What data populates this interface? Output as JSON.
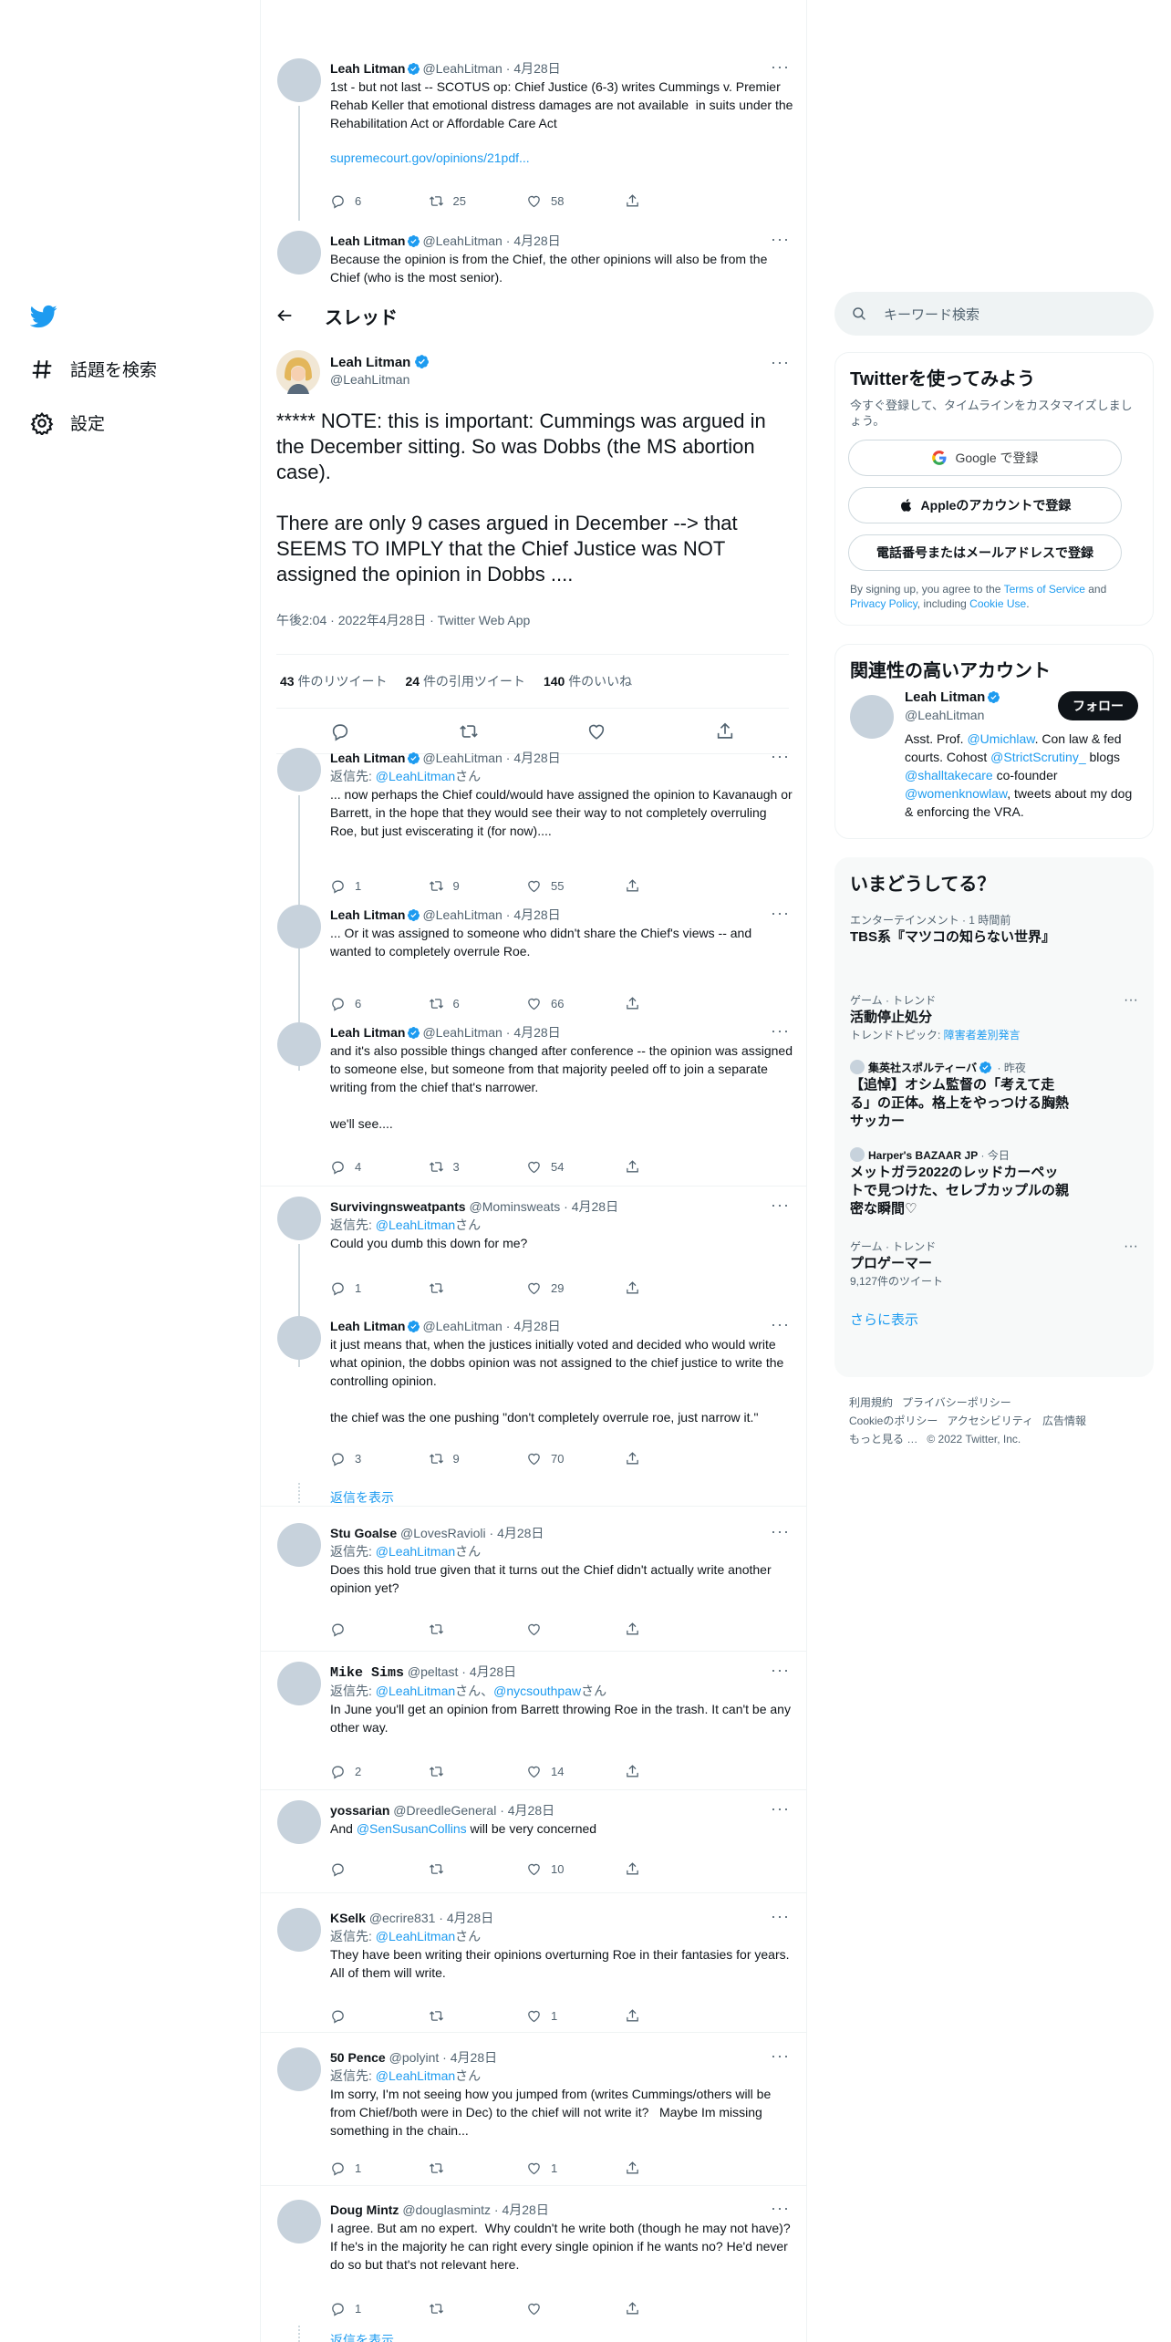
{
  "nav": {
    "explore_label": "話題を検索",
    "settings_label": "設定"
  },
  "thread_header": {
    "title": "スレッド"
  },
  "verified_color": "#1d9bf0",
  "link_color": "#1d9bf0",
  "above_tweets": [
    {
      "name": "Leah Litman",
      "verified": true,
      "handle": "@LeahLitman",
      "time": "4月28日",
      "text": "1st - but not last -- SCOTUS op: Chief Justice (6-3) writes Cummings v. Premier Rehab Keller that emotional distress damages are not available  in suits under the Rehabilitation Act or Affordable Care Act",
      "link": "supremecourt.gov/opinions/21pdf...",
      "reply_count": "6",
      "retweet_count": "25",
      "like_count": "58"
    },
    {
      "name": "Leah Litman",
      "verified": true,
      "handle": "@LeahLitman",
      "time": "4月28日",
      "text": "Because the opinion is from the Chief, the other opinions will also be from the Chief (who is the most senior)."
    }
  ],
  "focus": {
    "name": "Leah Litman",
    "handle": "@LeahLitman",
    "text": "***** NOTE: this is important: Cummings was argued in the December sitting. So was Dobbs (the MS abortion case).\n\nThere are only 9 cases argued in December --> that SEEMS TO IMPLY that the Chief Justice was NOT assigned the opinion in Dobbs ....",
    "meta": "午後2:04 · 2022年4月28日 · Twitter Web App",
    "retweets": "43",
    "retweets_label": "件のリツイート",
    "quotes": "24",
    "quotes_label": "件の引用ツイート",
    "likes": "140",
    "likes_label": "件のいいね"
  },
  "replies": [
    {
      "name": "Leah Litman",
      "verified": true,
      "handle": "@LeahLitman",
      "time": "4月28日",
      "reply_prefix": "返信先: ",
      "reply_to": "@LeahLitman",
      "reply_suffix": "さん",
      "text": "... now perhaps the Chief could/would have assigned the opinion to Kavanaugh or Barrett, in the hope that they would see their way to not completely overruling Roe, but just eviscerating it (for now)....",
      "reply_count": "1",
      "retweet_count": "9",
      "like_count": "55"
    },
    {
      "name": "Leah Litman",
      "verified": true,
      "handle": "@LeahLitman",
      "time": "4月28日",
      "text": "... Or it was assigned to someone who didn't share the Chief's views -- and wanted to completely overrule Roe.",
      "reply_count": "6",
      "retweet_count": "6",
      "like_count": "66"
    },
    {
      "name": "Leah Litman",
      "verified": true,
      "handle": "@LeahLitman",
      "time": "4月28日",
      "text": "and it's also possible things changed after conference -- the opinion was assigned to someone else, but someone from that majority peeled off to join a separate writing from the chief that's narrower.\n\nwe'll see....",
      "reply_count": "4",
      "retweet_count": "3",
      "like_count": "54"
    },
    {
      "name": "Survivingnsweatpants",
      "handle": "@Mominsweats",
      "time": "4月28日",
      "reply_prefix": "返信先: ",
      "reply_to": "@LeahLitman",
      "reply_suffix": "さん",
      "text": "Could you dumb this down for me?",
      "reply_count": "1",
      "retweet_count": "",
      "like_count": "29"
    },
    {
      "name": "Leah Litman",
      "verified": true,
      "handle": "@LeahLitman",
      "time": "4月28日",
      "text": "it just means that, when the justices initially voted and decided who would write what opinion, the dobbs opinion was not assigned to the chief justice to write the controlling opinion.\n\nthe chief was the one pushing \"don't completely overrule roe, just narrow it.\"",
      "reply_count": "3",
      "retweet_count": "9",
      "like_count": "70"
    },
    {
      "name": "Stu Goalse",
      "handle": "@LovesRavioli",
      "time": "4月28日",
      "reply_prefix": "返信先: ",
      "reply_to": "@LeahLitman",
      "reply_suffix": "さん",
      "text": "Does this hold true given that it turns out the Chief didn't actually write another opinion yet?",
      "reply_count": "",
      "retweet_count": "",
      "like_count": ""
    },
    {
      "name": "Mike Sims",
      "handle": "@peltast",
      "time": "4月28日",
      "reply_prefix": "返信先: ",
      "reply_to": "@LeahLitman",
      "reply_mid": "さん、",
      "reply_to2": "@nycsouthpaw",
      "reply_suffix": "さん",
      "text": "In June you'll get an opinion from Barrett throwing Roe in the trash. It can't be any other way.",
      "reply_count": "2",
      "retweet_count": "",
      "like_count": "14"
    },
    {
      "name": "yossarian",
      "handle": "@DreedleGeneral",
      "time": "4月28日",
      "text_prefix": "And ",
      "mention": "@SenSusanCollins",
      "text_suffix": " will be very concerned",
      "reply_count": "",
      "retweet_count": "",
      "like_count": "10"
    },
    {
      "name": "KSelk",
      "handle": "@ecrire831",
      "time": "4月28日",
      "reply_prefix": "返信先: ",
      "reply_to": "@LeahLitman",
      "reply_suffix": "さん",
      "text": "They have been writing their opinions overturning Roe in their fantasies for years.  All of them will write.",
      "reply_count": "",
      "retweet_count": "",
      "like_count": "1"
    },
    {
      "name": "50 Pence",
      "handle": "@polyint",
      "time": "4月28日",
      "reply_prefix": "返信先: ",
      "reply_to": "@LeahLitman",
      "reply_suffix": "さん",
      "text": "Im sorry, I'm not seeing how you jumped from (writes Cummings/others will be from Chief/both were in Dec) to the chief will not write it?   Maybe Im missing something in the chain...",
      "reply_count": "1",
      "retweet_count": "",
      "like_count": "1"
    },
    {
      "name": "Doug Mintz",
      "handle": "@douglasmintz",
      "time": "4月28日",
      "text": "I agree. But am no expert.  Why couldn't he write both (though he may not have)? If he's in the majority he can right every single opinion if he wants no? He'd never do so but that's not relevant here.",
      "reply_count": "1",
      "retweet_count": "",
      "like_count": ""
    }
  ],
  "show_replies_label": "返信を表示",
  "sidebar": {
    "search_placeholder": "キーワード検索",
    "signup": {
      "title": "Twitterを使ってみよう",
      "subtitle": "今すぐ登録して、タイムラインをカスタマイズしましょう。",
      "google_btn": "Google で登録",
      "apple_btn": "Appleのアカウントで登録",
      "phone_btn": "電話番号またはメールアドレスで登録",
      "terms_prefix": "By signing up, you agree to the ",
      "terms_link": "Terms of Service",
      "terms_and": " and ",
      "privacy_link": "Privacy Policy",
      "terms_including": ", including ",
      "cookie_link": "Cookie Use",
      "terms_end": "."
    },
    "related": {
      "title": "関連性の高いアカウント",
      "name": "Leah Litman",
      "handle": "@LeahLitman",
      "follow_label": "フォロー",
      "bio_1": "Asst. Prof. ",
      "bio_m1": "@Umichlaw",
      "bio_2": ". Con law & fed courts. Cohost ",
      "bio_m2": "@StrictScrutiny_",
      "bio_3": " blogs ",
      "bio_m3": "@shalltakecare",
      "bio_4": " co-founder ",
      "bio_m4": "@womenknowlaw",
      "bio_5": ", tweets about my dog      & enforcing the VRA."
    },
    "trends": {
      "title": "いまどうしてる？",
      "items": [
        {
          "context": "エンターテインメント · 1 時間前",
          "name": "TBS系『マツコの知らない世界』"
        },
        {
          "context": "ゲーム · トレンド",
          "name": "活動停止処分",
          "sub_prefix": "トレンドトピック: ",
          "sub_link": "障害者差別発言"
        },
        {
          "source": "集英社スポルティーバ",
          "time": "昨夜",
          "name": "【追悼】オシム監督の「考えて走る」の正体。格上をやっつける胸熱サッカー"
        },
        {
          "source": "Harper's BAZAAR JP",
          "time": "今日",
          "name": "メットガラ2022のレッドカーペットで見つけた、セレブカップルの親密な瞬間♡"
        },
        {
          "context": "ゲーム · トレンド",
          "name": "プロゲーマー",
          "sub": "9,127件のツイート"
        }
      ],
      "show_more": "さらに表示"
    },
    "footer": {
      "links": [
        "利用規約",
        "プライバシーポリシー",
        "Cookieのポリシー",
        "アクセシビリティ",
        "広告情報",
        "もっと見る …"
      ],
      "copyright": "© 2022 Twitter, Inc."
    }
  }
}
